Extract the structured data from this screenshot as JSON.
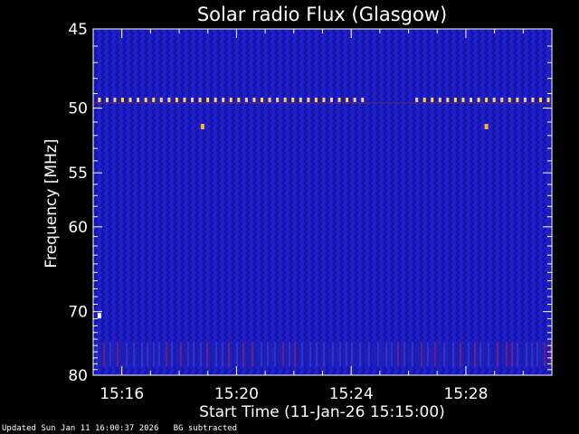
{
  "chart_data": {
    "type": "heatmap",
    "title": "Solar radio Flux (Glasgow)",
    "xlabel": "Start Time (11-Jan-26 15:15:00)",
    "ylabel": "Frequency [MHz]",
    "x_start_minutes": 0,
    "x_end_minutes": 16.0,
    "ylim": [
      45,
      80
    ],
    "y_scale": "log",
    "x_ticks": [
      {
        "minute": 1,
        "label": "15:16"
      },
      {
        "minute": 5,
        "label": "15:20"
      },
      {
        "minute": 9,
        "label": "15:24"
      },
      {
        "minute": 13,
        "label": "15:28"
      }
    ],
    "y_ticks": [
      {
        "value": 45,
        "label": "45"
      },
      {
        "value": 50,
        "label": "50"
      },
      {
        "value": 55,
        "label": "55"
      },
      {
        "value": 60,
        "label": "60"
      },
      {
        "value": 70,
        "label": "70"
      },
      {
        "value": 80,
        "label": "80"
      }
    ],
    "background_color": "#1c1cc4",
    "interference_band_mhz": [
      74.5,
      78.5
    ],
    "periodic_signal_mhz": 49.4,
    "periodic_signal_color": "#ffd060",
    "periodic_signal_gap_minutes": [
      9.6,
      11.2
    ],
    "hot_pixels": [
      {
        "minute": 3.8,
        "mhz": 51.3,
        "color": "#ffb030"
      },
      {
        "minute": 13.7,
        "mhz": 51.3,
        "color": "#ffb030"
      },
      {
        "minute": 0.2,
        "mhz": 70.5,
        "color": "#ffffff"
      }
    ]
  },
  "footer": {
    "updated": "Updated Sun Jan 11 16:00:37 2026",
    "note": "BG subtracted"
  }
}
